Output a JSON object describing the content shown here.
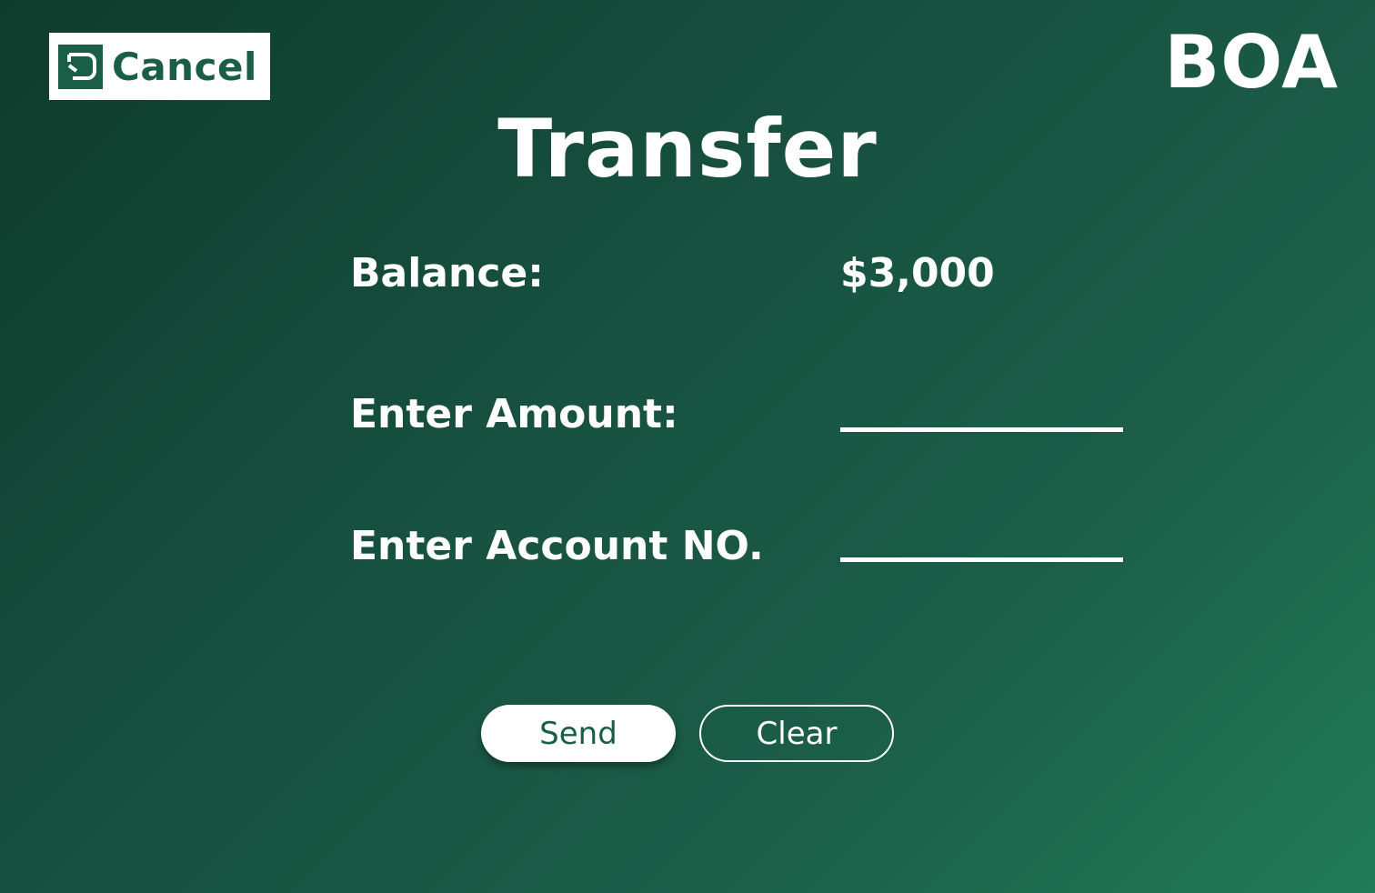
{
  "header": {
    "cancel_label": "Cancel",
    "cancel_icon": "exit-icon",
    "brand": "BOA"
  },
  "main": {
    "title": "Transfer",
    "balance_label": "Balance:",
    "balance_value": "$3,000",
    "amount_label": "Enter Amount:",
    "amount_value": "",
    "account_label": "Enter Account NO.",
    "account_value": ""
  },
  "actions": {
    "send_label": "Send",
    "clear_label": "Clear"
  },
  "colors": {
    "accent": "#1b5e48",
    "background_dark": "#0f3b2c",
    "background_light": "#217a59",
    "text": "#ffffff"
  }
}
